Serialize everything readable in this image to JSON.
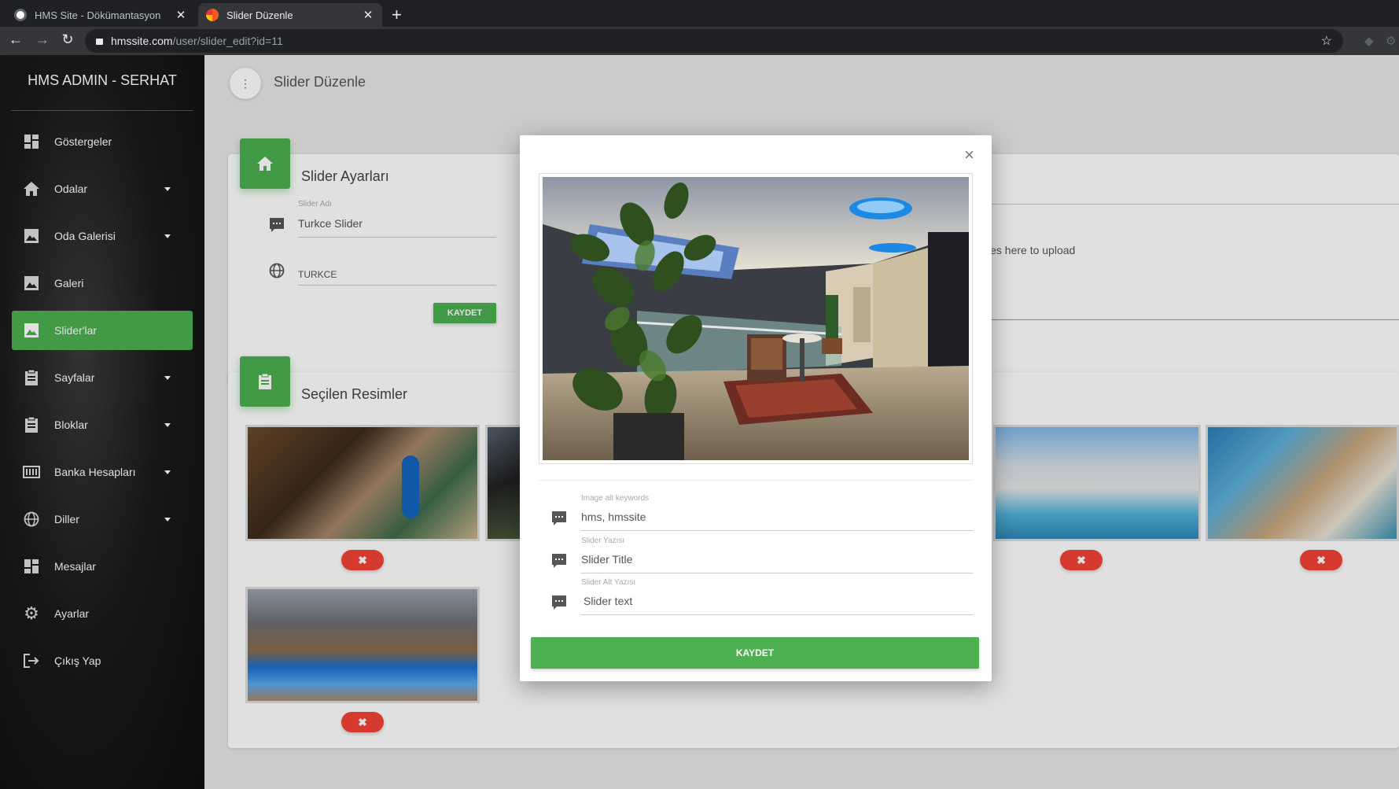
{
  "browser": {
    "tabs": [
      {
        "label": "HMS Site - Dökümantasyon",
        "active": false
      },
      {
        "label": "Slider Düzenle",
        "active": true
      }
    ],
    "url_host": "hmssite.com",
    "url_path": "/user/slider_edit?id=11"
  },
  "sidebar": {
    "brand": "HMS ADMIN - SERHAT",
    "items": [
      {
        "label": "Göstergeler",
        "icon": "dashboard-icon",
        "has_caret": false
      },
      {
        "label": "Odalar",
        "icon": "home-icon",
        "has_caret": true
      },
      {
        "label": "Oda Galerisi",
        "icon": "image-icon",
        "has_caret": true
      },
      {
        "label": "Galeri",
        "icon": "image-icon",
        "has_caret": false
      },
      {
        "label": "Slider'lar",
        "icon": "image-icon",
        "has_caret": false,
        "active": true
      },
      {
        "label": "Sayfalar",
        "icon": "clipboard-icon",
        "has_caret": true
      },
      {
        "label": "Bloklar",
        "icon": "clipboard-icon",
        "has_caret": true
      },
      {
        "label": "Banka Hesapları",
        "icon": "bank-icon",
        "has_caret": true
      },
      {
        "label": "Diller",
        "icon": "globe-icon",
        "has_caret": true
      },
      {
        "label": "Mesajlar",
        "icon": "dashboard-icon",
        "has_caret": false
      },
      {
        "label": "Ayarlar",
        "icon": "gear-icon",
        "has_caret": false
      },
      {
        "label": "Çıkış Yap",
        "icon": "logout-icon",
        "has_caret": false
      }
    ]
  },
  "main": {
    "page_title": "Slider Düzenle",
    "settings_card": {
      "title": "Slider Ayarları",
      "name_label": "Slider Adı",
      "name_value": "Turkce Slider",
      "language_value": "TURKCE",
      "save_label": "KAYDET"
    },
    "upload_hint": "les here to upload",
    "selected_card": {
      "title": "Seçilen Resimler"
    }
  },
  "modal": {
    "close_label": "×",
    "fields": [
      {
        "label": "Image alt keywords",
        "value": "hms, hmssite"
      },
      {
        "label": "Slider Yazısı",
        "value": "Slider Title"
      },
      {
        "label": "Slider Alt Yazısı",
        "value": "Slider text"
      }
    ],
    "save_label": "KAYDET"
  },
  "colors": {
    "accent": "#4caf50",
    "danger": "#f44336"
  }
}
